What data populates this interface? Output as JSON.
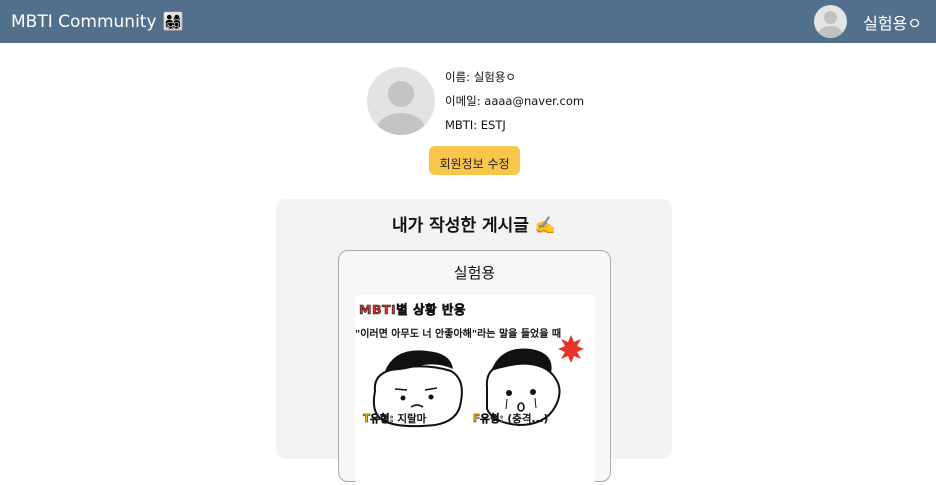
{
  "navbar": {
    "brand": "MBTI Community",
    "brand_emoji": "👨‍👩‍👧‍👦",
    "user_name": "실험용ㅇ",
    "background": "#526f8c"
  },
  "profile": {
    "name_line": "이름: 실험용ㅇ",
    "email_line": "이메일: aaaa@naver.com",
    "mbti_line": "MBTI: ESTJ",
    "edit_button": "회원정보 수정",
    "edit_button_color": "#f7c64b"
  },
  "posts": {
    "title": "내가 작성한 게시글 ✍️",
    "items": [
      {
        "title": "실험용",
        "thumbnail": {
          "heading": "MBTI별 상황 반응",
          "quote": "\"이러면 아무도 너 안좋아해\"라는 말을 들었을 때",
          "left_tag": "T유형:",
          "left_text": " 지랄마",
          "right_tag": "F유형:",
          "right_text": " (충격...)"
        }
      }
    ]
  }
}
